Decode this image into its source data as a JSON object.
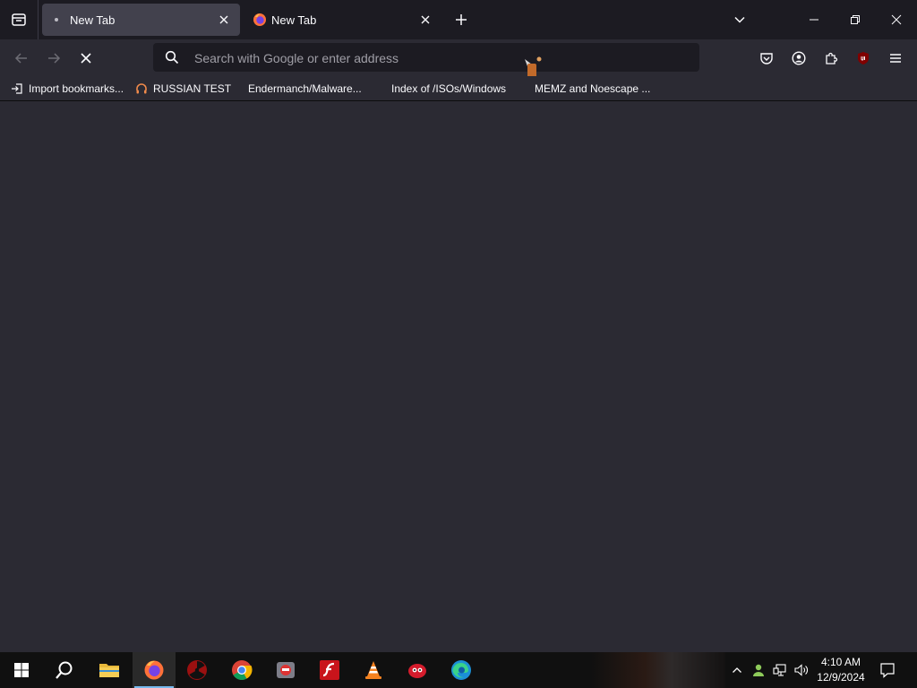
{
  "browser": {
    "tabs": [
      {
        "label": "New Tab",
        "active": true,
        "close_symbol": "✕"
      },
      {
        "label": "New Tab",
        "active": false,
        "close_symbol": "✕"
      }
    ],
    "new_tab_symbol": "+",
    "window_controls": {
      "minimize": "minimize-icon",
      "restore": "restore-icon",
      "close": "close-icon"
    }
  },
  "navbar": {
    "url_placeholder": "Search with Google or enter address",
    "url_value": ""
  },
  "bookmarks": [
    {
      "label": "Import bookmarks...",
      "icon": "import-icon"
    },
    {
      "label": "RUSSIAN TEST",
      "icon": "headphones-icon"
    },
    {
      "label": "Endermanch/Malware...",
      "icon": "none"
    },
    {
      "label": "Index of /ISOs/Windows",
      "icon": "none"
    },
    {
      "label": "MEMZ and Noescape ...",
      "icon": "none"
    }
  ],
  "taskbar": {
    "apps": [
      "start",
      "search",
      "file-explorer",
      "firefox",
      "radiation-app",
      "chrome",
      "game-app",
      "flash-player",
      "vlc",
      "red-app",
      "edge"
    ],
    "clock": {
      "time": "4:10 AM",
      "date": "12/9/2024"
    }
  },
  "colors": {
    "tabstrip_bg": "#1c1b22",
    "toolbar_bg": "#2b2a33",
    "active_tab_bg": "#42414d",
    "urlbar_bg": "#1c1b22",
    "taskbar_bg": "#101010"
  }
}
